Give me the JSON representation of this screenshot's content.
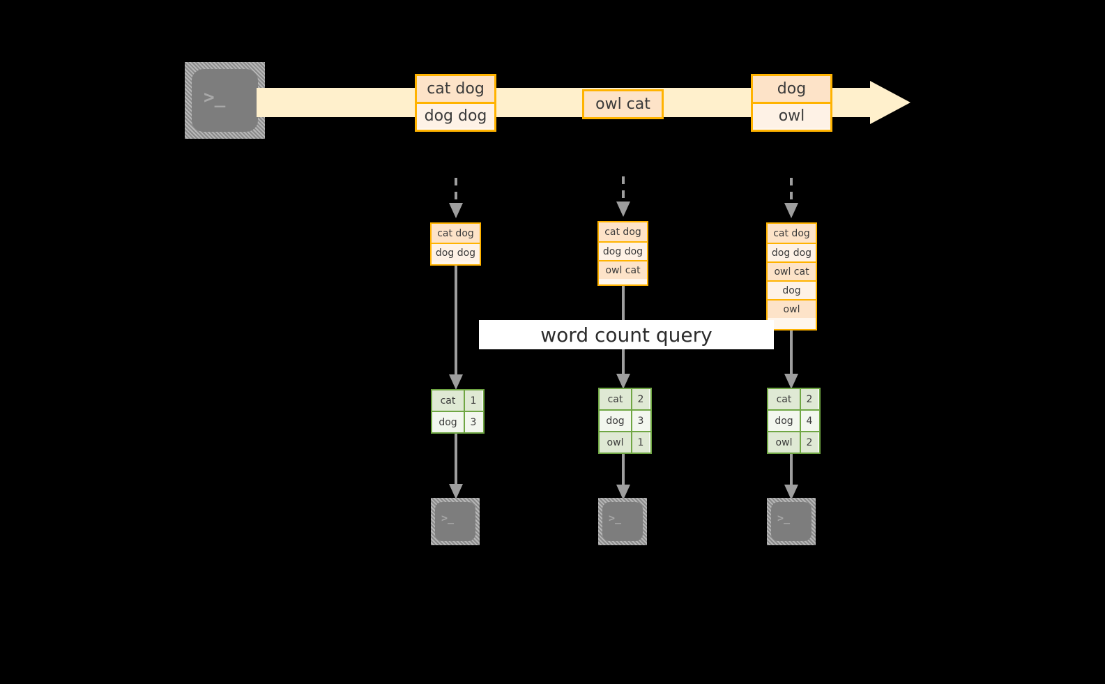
{
  "diagram": {
    "title": "word count query",
    "colors": {
      "background": "#000000",
      "event_border": "#FFB300",
      "event_fill_dark": "#FDE3C8",
      "event_fill_light": "#FEF2E6",
      "stream_fill": "#FFF0CC",
      "table_border": "#6FA643",
      "table_fill_dark": "#DFE9D4",
      "table_fill_light": "#F3F7EF",
      "connector": "#9E9E9E",
      "terminal_fill": "#7D7D7D",
      "label_fill": "#FFFFFF"
    },
    "terminal_glyph": ">_",
    "producer": {
      "name": "producer-terminal"
    },
    "stream": {
      "name": "event-stream",
      "events": [
        {
          "id": "e1",
          "rows": [
            {
              "text": "cat dog",
              "shade": "dark"
            },
            {
              "text": "dog dog",
              "shade": "light"
            }
          ]
        },
        {
          "id": "e2",
          "rows": [
            {
              "text": "owl cat",
              "shade": "dark"
            }
          ]
        },
        {
          "id": "e3",
          "rows": [
            {
              "text": "dog",
              "shade": "dark"
            },
            {
              "text": "owl",
              "shade": "light"
            }
          ]
        }
      ]
    },
    "snapshots": [
      {
        "id": "s1",
        "rows": [
          {
            "text": "cat dog",
            "shade": "dark"
          },
          {
            "text": "dog dog",
            "shade": "light"
          }
        ]
      },
      {
        "id": "s2",
        "rows": [
          {
            "text": "cat dog",
            "shade": "dark"
          },
          {
            "text": "dog dog",
            "shade": "light"
          },
          {
            "text": "owl cat",
            "shade": "dark"
          }
        ]
      },
      {
        "id": "s3",
        "rows": [
          {
            "text": "cat dog",
            "shade": "dark"
          },
          {
            "text": "dog dog",
            "shade": "light"
          },
          {
            "text": "owl cat",
            "shade": "dark"
          },
          {
            "text": "dog",
            "shade": "light"
          },
          {
            "text": "owl",
            "shade": "dark"
          }
        ]
      }
    ],
    "results": [
      {
        "id": "r1",
        "rows": [
          {
            "key": "cat",
            "value": "1",
            "shade": "dark"
          },
          {
            "key": "dog",
            "value": "3",
            "shade": "light"
          }
        ]
      },
      {
        "id": "r2",
        "rows": [
          {
            "key": "cat",
            "value": "2",
            "shade": "dark"
          },
          {
            "key": "dog",
            "value": "3",
            "shade": "light"
          },
          {
            "key": "owl",
            "value": "1",
            "shade": "dark"
          }
        ]
      },
      {
        "id": "r3",
        "rows": [
          {
            "key": "cat",
            "value": "2",
            "shade": "dark"
          },
          {
            "key": "dog",
            "value": "4",
            "shade": "light"
          },
          {
            "key": "owl",
            "value": "2",
            "shade": "dark"
          }
        ]
      }
    ],
    "consumers": [
      {
        "name": "consumer-terminal-1"
      },
      {
        "name": "consumer-terminal-2"
      },
      {
        "name": "consumer-terminal-3"
      }
    ]
  }
}
